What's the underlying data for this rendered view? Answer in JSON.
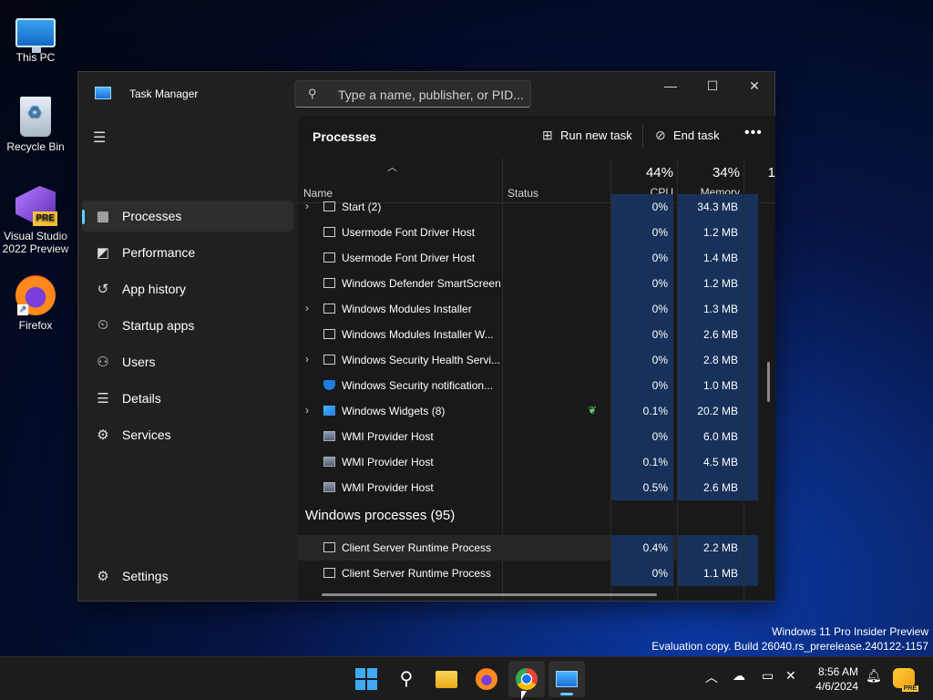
{
  "desktop": {
    "icons": [
      {
        "label": "This PC",
        "icon": "computer-icon"
      },
      {
        "label": "Recycle Bin",
        "icon": "recycle-bin-icon"
      },
      {
        "label": "Visual Studio 2022 Preview",
        "icon": "visual-studio-icon",
        "badge": "PRE"
      },
      {
        "label": "Firefox",
        "icon": "firefox-icon"
      }
    ],
    "watermark": {
      "line1": "Windows 11 Pro Insider Preview",
      "line2": "Evaluation copy. Build 26040.rs_prerelease.240122-1157"
    }
  },
  "window": {
    "title": "Task Manager",
    "search_placeholder": "Type a name, publisher, or PID...",
    "controls": {
      "minimize": "—",
      "maximize": "☐",
      "close": "✕"
    },
    "nav": [
      {
        "label": "Processes",
        "icon": "processes-icon",
        "glyph": "▦",
        "active": true
      },
      {
        "label": "Performance",
        "icon": "performance-icon",
        "glyph": "◩"
      },
      {
        "label": "App history",
        "icon": "history-icon",
        "glyph": "↺"
      },
      {
        "label": "Startup apps",
        "icon": "startup-icon",
        "glyph": "⏲"
      },
      {
        "label": "Users",
        "icon": "users-icon",
        "glyph": "⚇"
      },
      {
        "label": "Details",
        "icon": "details-icon",
        "glyph": "☰"
      },
      {
        "label": "Services",
        "icon": "services-icon",
        "glyph": "⚙"
      }
    ],
    "settings_label": "Settings",
    "page_title": "Processes",
    "commands": {
      "run_new_task": "Run new task",
      "end_task": "End task",
      "more": "•••"
    },
    "columns": {
      "name": "Name",
      "status": "Status",
      "cpu_pct": "44%",
      "cpu": "CPU",
      "memory_pct": "34%",
      "memory": "Memory",
      "next_pct": "1"
    },
    "rows": [
      {
        "name": "Start (2)",
        "expand": true,
        "icon": "app",
        "cpu": "0%",
        "mem": "34.3 MB"
      },
      {
        "name": "Usermode Font Driver Host",
        "icon": "app",
        "cpu": "0%",
        "mem": "1.2 MB"
      },
      {
        "name": "Usermode Font Driver Host",
        "icon": "app",
        "cpu": "0%",
        "mem": "1.4 MB"
      },
      {
        "name": "Windows Defender SmartScreen",
        "icon": "app",
        "cpu": "0%",
        "mem": "1.2 MB"
      },
      {
        "name": "Windows Modules Installer",
        "expand": true,
        "icon": "app",
        "cpu": "0%",
        "mem": "1.3 MB"
      },
      {
        "name": "Windows Modules Installer W...",
        "icon": "app",
        "cpu": "0%",
        "mem": "2.6 MB"
      },
      {
        "name": "Windows Security Health Servi...",
        "expand": true,
        "icon": "app",
        "cpu": "0%",
        "mem": "2.8 MB"
      },
      {
        "name": "Windows Security notification...",
        "icon": "shield",
        "cpu": "0%",
        "mem": "1.0 MB"
      },
      {
        "name": "Windows Widgets (8)",
        "expand": true,
        "icon": "widget",
        "efficiency": true,
        "cpu": "0.1%",
        "mem": "20.2 MB"
      },
      {
        "name": "WMI Provider Host",
        "icon": "wmi",
        "cpu": "0%",
        "mem": "6.0 MB"
      },
      {
        "name": "WMI Provider Host",
        "icon": "wmi",
        "cpu": "0.1%",
        "mem": "4.5 MB"
      },
      {
        "name": "WMI Provider Host",
        "icon": "wmi",
        "cpu": "0.5%",
        "mem": "2.6 MB"
      }
    ],
    "group_label": "Windows processes (95)",
    "group_rows": [
      {
        "name": "Client Server Runtime Process",
        "icon": "app",
        "cpu": "0.4%",
        "mem": "2.2 MB",
        "highlight": true
      },
      {
        "name": "Client Server Runtime Process",
        "icon": "app",
        "cpu": "0%",
        "mem": "1.1 MB"
      }
    ]
  },
  "taskbar": {
    "apps": [
      "start-icon",
      "search-icon",
      "file-explorer-icon",
      "firefox-icon",
      "chrome-icon",
      "task-manager-icon"
    ],
    "time": "8:56 AM",
    "date": "4/6/2024",
    "copilot_badge": "PRE"
  }
}
